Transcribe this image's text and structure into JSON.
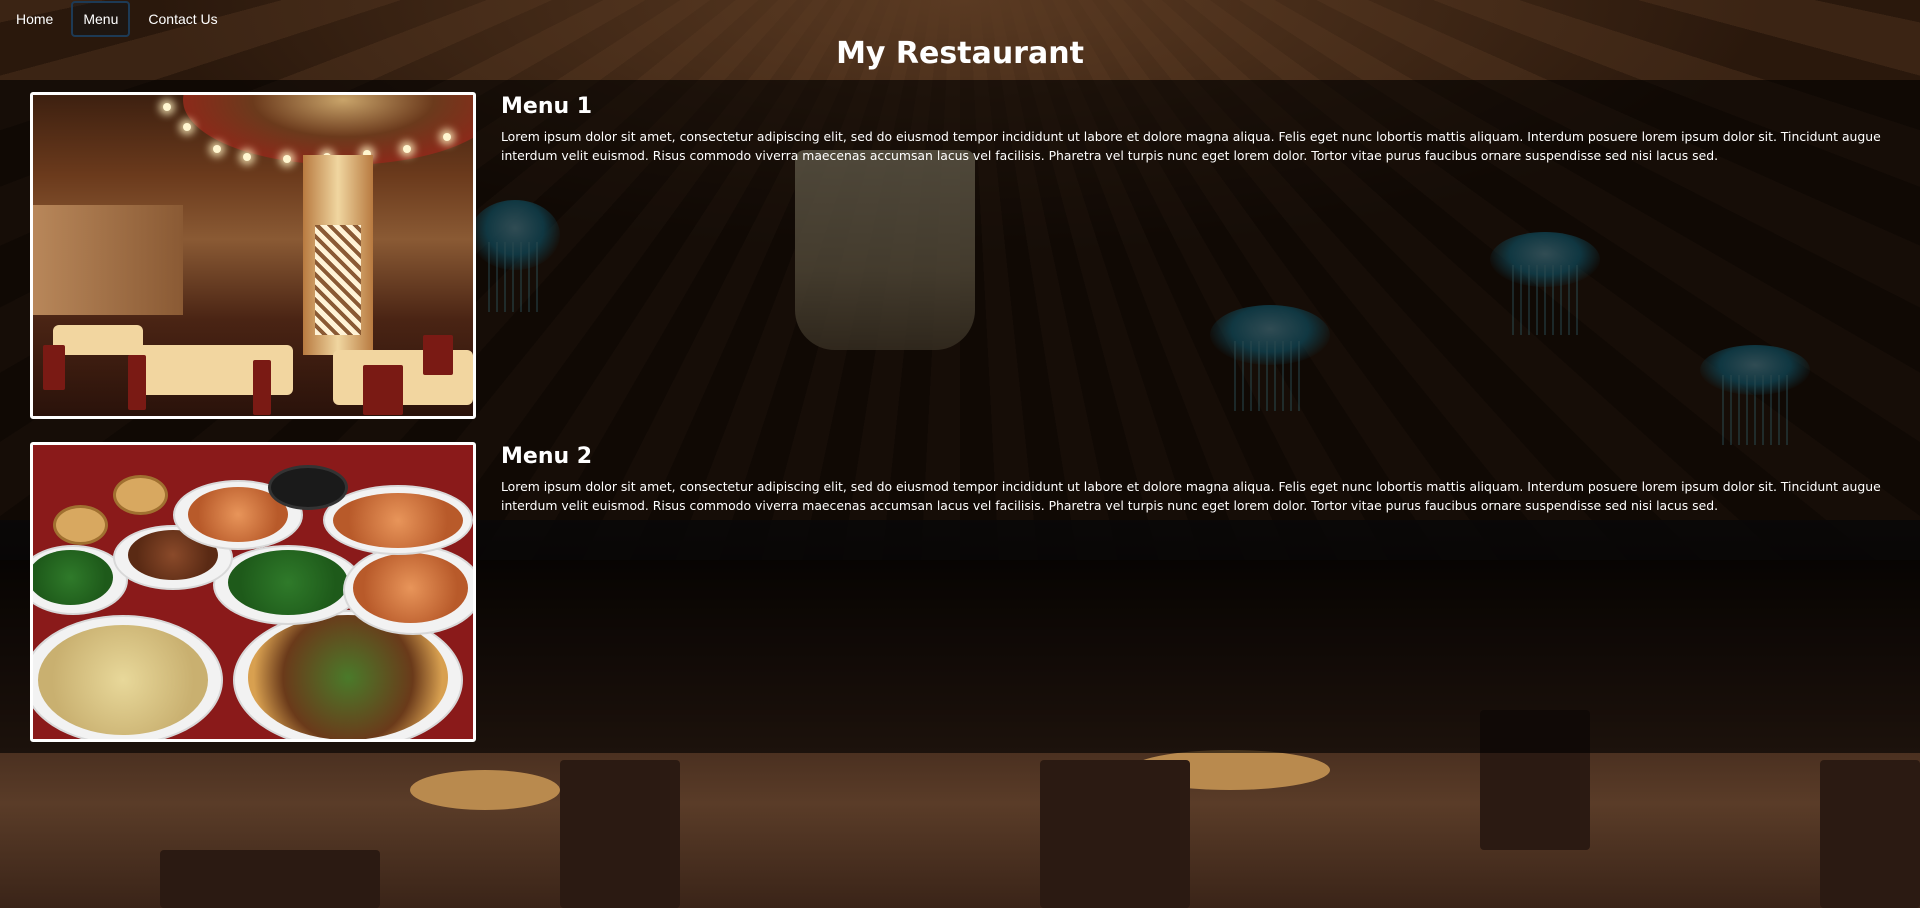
{
  "nav": {
    "items": [
      {
        "label": "Home",
        "active": false
      },
      {
        "label": "Menu",
        "active": true
      },
      {
        "label": "Contact Us",
        "active": false
      }
    ]
  },
  "page": {
    "title": "My Restaurant"
  },
  "menus": [
    {
      "heading": "Menu 1",
      "description": "Lorem ipsum dolor sit amet, consectetur adipiscing elit, sed do eiusmod tempor incididunt ut labore et dolore magna aliqua. Felis eget nunc lobortis mattis aliquam. Interdum posuere lorem ipsum dolor sit. Tincidunt augue interdum velit euismod. Risus commodo viverra maecenas accumsan lacus vel facilisis. Pharetra vel turpis nunc eget lorem dolor. Tortor vitae purus faucibus ornare suspendisse sed nisi lacus sed.",
      "photo": "dining-room-photo"
    },
    {
      "heading": "Menu 2",
      "description": "Lorem ipsum dolor sit amet, consectetur adipiscing elit, sed do eiusmod tempor incididunt ut labore et dolore magna aliqua. Felis eget nunc lobortis mattis aliquam. Interdum posuere lorem ipsum dolor sit. Tincidunt augue interdum velit euismod. Risus commodo viverra maecenas accumsan lacus vel facilisis. Pharetra vel turpis nunc eget lorem dolor. Tortor vitae purus faucibus ornare suspendisse sed nisi lacus sed.",
      "photo": "food-dishes-photo"
    }
  ],
  "colors": {
    "text": "#ffffff",
    "panel_overlay": "#000000",
    "active_nav_border": "#1d3a55",
    "photo_border": "#ffffff"
  }
}
